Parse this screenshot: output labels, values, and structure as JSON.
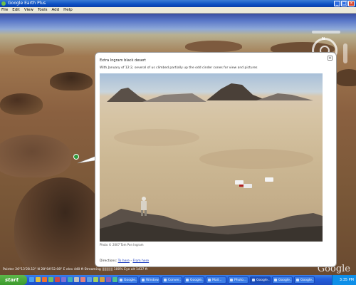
{
  "window": {
    "title": "Google Earth Plus",
    "buttons": [
      "_",
      "□",
      "×"
    ]
  },
  "menu": [
    "File",
    "Edit",
    "View",
    "Tools",
    "Add",
    "Help"
  ],
  "nav": {
    "north": "N"
  },
  "balloon": {
    "heading": "Extra Ingram black desert",
    "description": "With January of 12:2, several of us climbed partially up the odd cinder cones for view and pictures",
    "close": "×",
    "photo_credit": "Photo © 2007 Tom Pon Ingram",
    "directions_prefix": "Directions: ",
    "to_here": "To here",
    "from_here": "From here"
  },
  "status": {
    "line": "Pointer   26°13'28.12\" N   28°04'52.08\" E   elev  440 ft      Streaming |||||||||| 100%      Eye alt  1437 ft"
  },
  "logo": "Google",
  "taskbar": {
    "start": "start",
    "tasks": [
      "Google...",
      "Window...",
      "Conver...",
      "Google...",
      "Mail...",
      "Photo...",
      "Google...",
      "Google...",
      "Google..."
    ],
    "clock": "3:35 PM"
  }
}
